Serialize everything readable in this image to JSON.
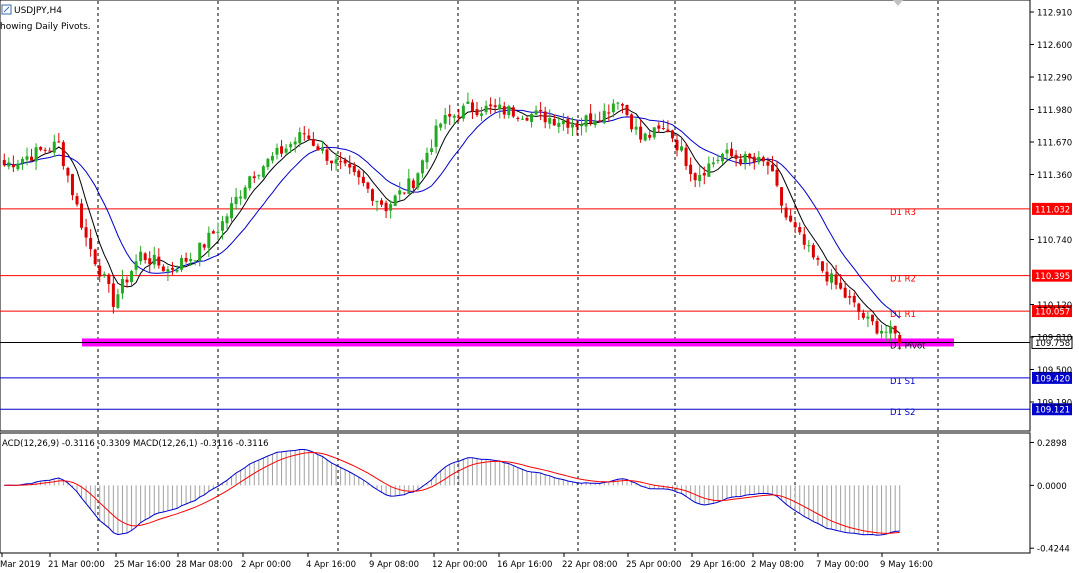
{
  "window": {
    "symbol_title": "USDJPY,H4",
    "indicator_note": "howing Daily Pivots."
  },
  "price_axis": {
    "ticks": [
      "112.910",
      "112.600",
      "112.290",
      "111.980",
      "111.670",
      "111.360",
      "110.740",
      "110.120",
      "109.810",
      "109.500",
      "109.190"
    ],
    "min": 109.0,
    "max": 113.0,
    "current_price": "109.758"
  },
  "pivots": [
    {
      "name": "D1 R3",
      "value": 111.032,
      "value_label": "111.032",
      "color": "#ff0000",
      "tag_color": "#ff0000"
    },
    {
      "name": "D1 R2",
      "value": 110.395,
      "value_label": "110.395",
      "color": "#ff0000",
      "tag_color": "#ff0000"
    },
    {
      "name": "D1 R1",
      "value": 110.057,
      "value_label": "110.057",
      "color": "#ff0000",
      "tag_color": "#ff0000"
    },
    {
      "name": "D1 Pivot",
      "value": 109.758,
      "value_label": "",
      "color": "#ff00ff",
      "tag_color": "#000000"
    },
    {
      "name": "D1 S1",
      "value": 109.42,
      "value_label": "109.420",
      "color": "#0000cc",
      "tag_color": "#0000cc"
    },
    {
      "name": "D1 S2",
      "value": 109.121,
      "value_label": "109.121",
      "color": "#0000cc",
      "tag_color": "#0000cc"
    }
  ],
  "time_axis": {
    "labels": [
      "Mar 2019",
      "21 Mar 00:00",
      "25 Mar 16:00",
      "28 Mar 08:00",
      "2 Apr 00:00",
      "4 Apr 16:00",
      "9 Apr 08:00",
      "12 Apr 00:00",
      "16 Apr 16:00",
      "22 Apr 08:00",
      "25 Apr 00:00",
      "29 Apr 16:00",
      "2 May 08:00",
      "7 May 00:00",
      "9 May 16:00"
    ]
  },
  "macd": {
    "label": "ACD(12,26,9) -0.3116 -0.3309 MACD(12,26,1) -0.3116 -0.3116",
    "ticks": [
      "0.2898",
      "0.0000",
      "-0.4244"
    ],
    "min": -0.45,
    "max": 0.32
  },
  "colors": {
    "bull": "#22aa22",
    "bear": "#dd0000",
    "ma_fast": "#000000",
    "ma_slow": "#0000cc",
    "macd_line": "#0000cc",
    "signal_line": "#ff0000",
    "histogram": "#a0a0a0",
    "pivot_band": "#ff00ff"
  },
  "chart_data": {
    "type": "candlestick",
    "title": "USDJPY,H4",
    "ylim": [
      109.0,
      113.0
    ],
    "close_anchors": [
      [
        0,
        111.45
      ],
      [
        12,
        111.65
      ],
      [
        18,
        110.75
      ],
      [
        24,
        110.15
      ],
      [
        30,
        110.6
      ],
      [
        36,
        110.45
      ],
      [
        42,
        110.6
      ],
      [
        48,
        110.9
      ],
      [
        54,
        111.35
      ],
      [
        60,
        111.55
      ],
      [
        66,
        111.75
      ],
      [
        72,
        111.5
      ],
      [
        78,
        111.3
      ],
      [
        84,
        111.05
      ],
      [
        90,
        111.3
      ],
      [
        96,
        111.85
      ],
      [
        102,
        112.0
      ],
      [
        108,
        111.98
      ],
      [
        114,
        111.95
      ],
      [
        120,
        111.9
      ],
      [
        126,
        111.85
      ],
      [
        132,
        111.95
      ],
      [
        135,
        112.1
      ],
      [
        140,
        111.7
      ],
      [
        146,
        111.8
      ],
      [
        152,
        111.35
      ],
      [
        158,
        111.55
      ],
      [
        163,
        111.5
      ],
      [
        168,
        111.45
      ],
      [
        172,
        110.95
      ],
      [
        178,
        110.55
      ],
      [
        184,
        110.25
      ],
      [
        190,
        109.95
      ],
      [
        197,
        109.8
      ]
    ]
  }
}
